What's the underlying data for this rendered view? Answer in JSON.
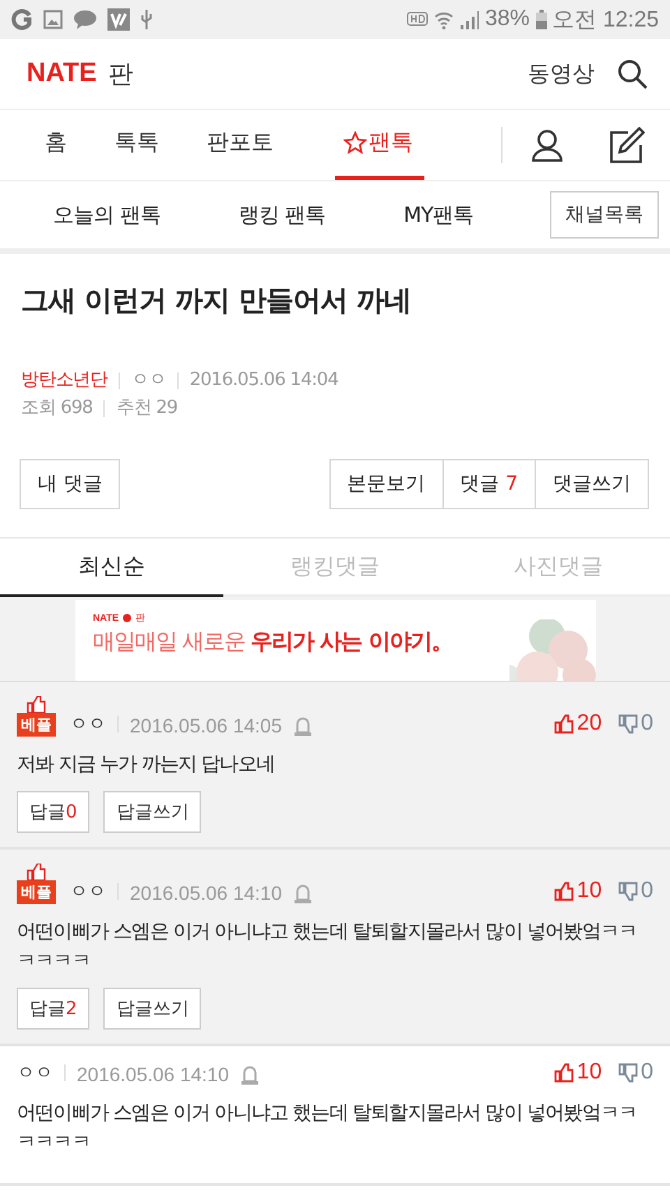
{
  "status_bar": {
    "battery": "38%",
    "time": "오전 12:25"
  },
  "header": {
    "logo": "NATE",
    "logo_suffix": "판",
    "video_link": "동영상"
  },
  "nav": [
    {
      "label": "홈",
      "selected": false,
      "star": false
    },
    {
      "label": "톡톡",
      "selected": false,
      "star": false
    },
    {
      "label": "판포토",
      "selected": false,
      "star": false
    },
    {
      "label": "팬톡",
      "selected": true,
      "star": true
    }
  ],
  "sub_nav": {
    "items": [
      "오늘의 팬톡",
      "랭킹 팬톡",
      "MY팬톡"
    ],
    "channel_button": "채널목록"
  },
  "post": {
    "title": "그새 이런거 까지 만들어서 까네",
    "channel": "방탄소년단",
    "author": "ㅇㅇ",
    "date": "2016.05.06 14:04",
    "views": "조회 698",
    "recommends": "추천 29"
  },
  "actions": {
    "my_comments": "내 댓글",
    "view_body": "본문보기",
    "comments_label": "댓글",
    "comments_count": "7",
    "write_comment": "댓글쓰기"
  },
  "comment_tabs": [
    {
      "label": "최신순",
      "selected": true
    },
    {
      "label": "랭킹댓글",
      "selected": false
    },
    {
      "label": "사진댓글",
      "selected": false
    }
  ],
  "banner": {
    "logo": "NATE",
    "logo_suffix": "판",
    "text": "매일매일 새로운 **우리가 사는 이야기。**"
  },
  "comments": [
    {
      "best": true,
      "badge": "베플",
      "author": "ㅇㅇ",
      "date": "2016.05.06 14:05",
      "likes": "20",
      "dislikes": "0",
      "body": "저봐 지금 누가 까는지 답나오네",
      "reply_label": "답글",
      "reply_count": "0",
      "write_reply": "답글쓰기"
    },
    {
      "best": true,
      "badge": "베플",
      "author": "ㅇㅇ",
      "date": "2016.05.06 14:10",
      "likes": "10",
      "dislikes": "0",
      "body": "어떤이삐가 스엠은 이거 아니냐고 했는데 탈퇴할지몰라서 많이 넣어봤엌ㅋㅋㅋㅋㅋㅋ",
      "reply_label": "답글",
      "reply_count": "2",
      "write_reply": "답글쓰기"
    },
    {
      "best": false,
      "author": "ㅇㅇ",
      "date": "2016.05.06 14:10",
      "likes": "10",
      "dislikes": "0",
      "body": "어떤이삐가 스엠은 이거 아니냐고 했는데 탈퇴할지몰라서 많이 넣어봤엌ㅋㅋㅋㅋㅋㅋ"
    }
  ]
}
